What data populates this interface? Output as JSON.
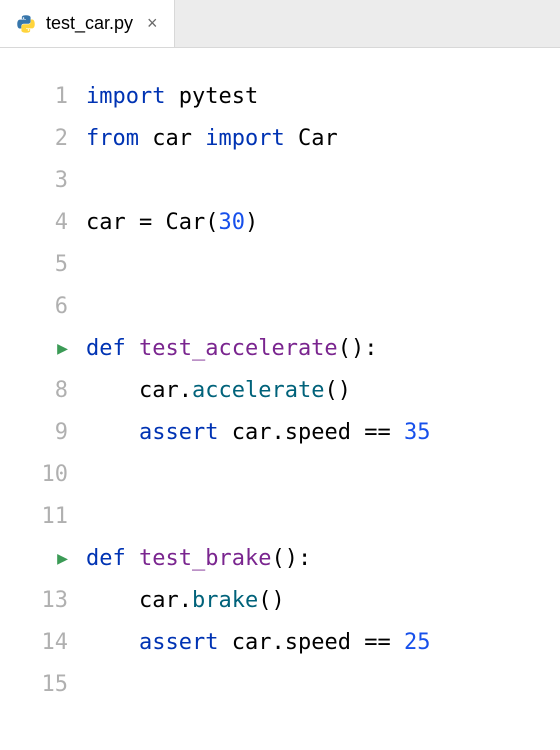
{
  "tab": {
    "filename": "test_car.py",
    "close_glyph": "×"
  },
  "gutter": {
    "ln1": "1",
    "ln2": "2",
    "ln3": "3",
    "ln4": "4",
    "ln5": "5",
    "ln6": "6",
    "ln7_is_run": true,
    "ln8": "8",
    "ln9": "9",
    "ln10": "10",
    "ln11": "11",
    "ln12_is_run": true,
    "ln13": "13",
    "ln14": "14",
    "ln15": "15"
  },
  "tok": {
    "import": "import",
    "from": "from",
    "def": "def",
    "assert": "assert",
    "pytest": "pytest",
    "car_mod": "car",
    "Car": "Car",
    "car_var": "car",
    "eq": "=",
    "lp": "(",
    "rp": ")",
    "colon": ":",
    "dot": ".",
    "comma": ",",
    "dbl_eq": "==",
    "n30": "30",
    "n35": "35",
    "n25": "25",
    "test_accelerate": "test_accelerate",
    "test_brake": "test_brake",
    "accelerate": "accelerate",
    "brake": "brake",
    "speed": "speed",
    "sp": " ",
    "indent": "    "
  }
}
